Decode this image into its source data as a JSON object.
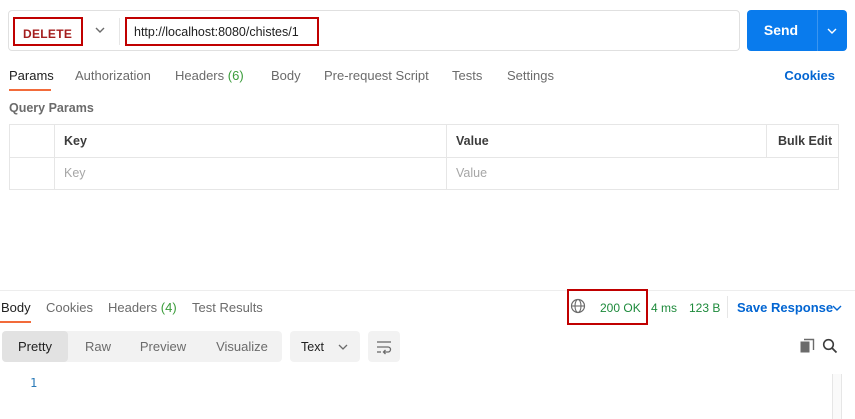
{
  "request": {
    "method": "DELETE",
    "url": "http://localhost:8080/chistes/1",
    "send_label": "Send"
  },
  "request_tabs": {
    "params": "Params",
    "authorization": "Authorization",
    "headers": "Headers",
    "headers_count": "(6)",
    "body": "Body",
    "pre_request_script": "Pre-request Script",
    "tests": "Tests",
    "settings": "Settings",
    "cookies": "Cookies"
  },
  "query_params": {
    "title": "Query Params",
    "col_key": "Key",
    "col_value": "Value",
    "bulk_edit": "Bulk Edit",
    "key_placeholder": "Key",
    "value_placeholder": "Value"
  },
  "response": {
    "tabs": {
      "body": "Body",
      "cookies": "Cookies",
      "headers": "Headers",
      "headers_count": "(4)",
      "test_results": "Test Results"
    },
    "status": "200 OK",
    "time": "4 ms",
    "size": "123 B",
    "save_response": "Save Response",
    "views": {
      "pretty": "Pretty",
      "raw": "Raw",
      "preview": "Preview",
      "visualize": "Visualize"
    },
    "format": "Text",
    "line_number": "1"
  },
  "colors": {
    "accent_orange": "#f26b3a",
    "send_blue": "#097bed",
    "link_blue": "#0265d2",
    "status_green": "#1d8a3b",
    "method_red": "#a41d1d",
    "highlight_red": "#c00000"
  },
  "icons": {
    "method_dropdown": "chevron-down-icon",
    "send_dropdown": "chevron-down-icon",
    "network": "globe-icon",
    "format_dropdown": "chevron-down-icon",
    "wrap": "wrap-lines-icon",
    "copy": "copy-icon",
    "search": "search-icon"
  }
}
